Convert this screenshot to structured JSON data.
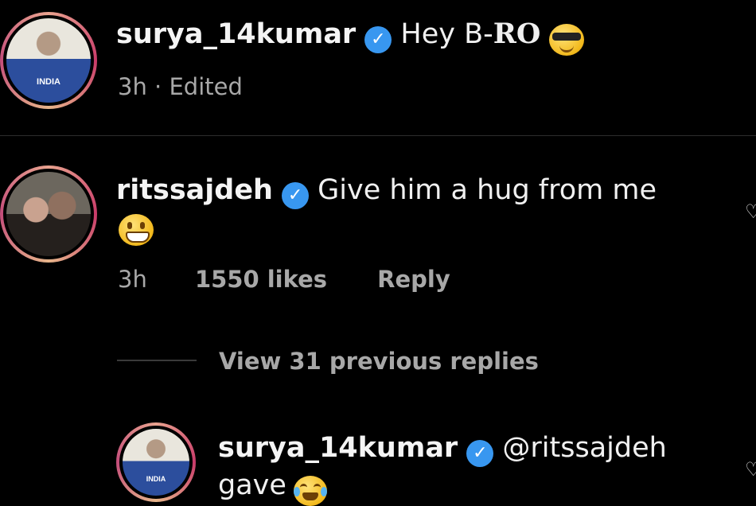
{
  "comments": [
    {
      "username": "surya_14kumar",
      "verified": true,
      "text": "Hey B-",
      "text_bold": "RO",
      "emoji": "smiling-face-with-sunglasses",
      "meta": "3h · Edited"
    },
    {
      "username": "ritssajdeh",
      "verified": true,
      "text": "Give him a hug from me",
      "emoji": "grinning-face-with-big-eyes",
      "time": "3h",
      "likes": "1550 likes",
      "reply_label": "Reply"
    }
  ],
  "view_replies": "View 31 previous replies",
  "reply": {
    "username": "surya_14kumar",
    "verified": true,
    "mention": "@ritssajdeh",
    "text": "gave",
    "emoji": "face-with-tears-of-joy"
  },
  "colors": {
    "background": "#000000",
    "verified": "#3897f0",
    "muted_text": "#a8a8a8",
    "story_ring": "#c93b6a"
  }
}
